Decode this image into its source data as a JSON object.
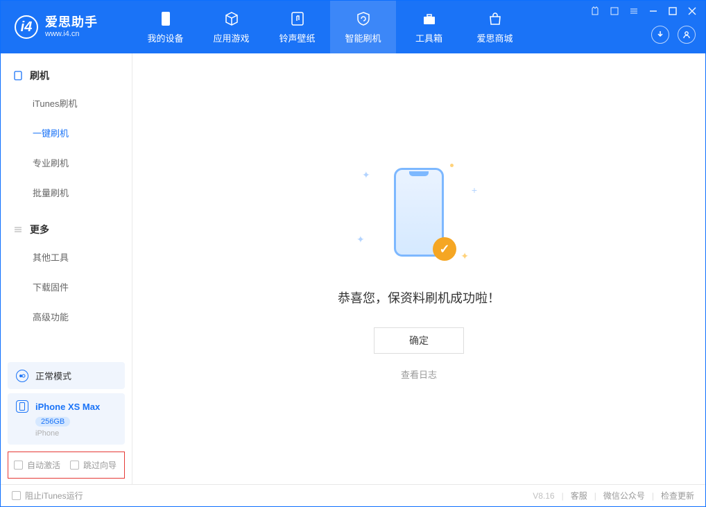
{
  "logo": {
    "title": "爱思助手",
    "subtitle": "www.i4.cn",
    "glyph": "i4"
  },
  "nav": {
    "tabs": [
      {
        "label": "我的设备"
      },
      {
        "label": "应用游戏"
      },
      {
        "label": "铃声壁纸"
      },
      {
        "label": "智能刷机"
      },
      {
        "label": "工具箱"
      },
      {
        "label": "爱思商城"
      }
    ]
  },
  "sidebar": {
    "section1": {
      "title": "刷机",
      "items": [
        {
          "label": "iTunes刷机"
        },
        {
          "label": "一键刷机"
        },
        {
          "label": "专业刷机"
        },
        {
          "label": "批量刷机"
        }
      ]
    },
    "section2": {
      "title": "更多",
      "items": [
        {
          "label": "其他工具"
        },
        {
          "label": "下载固件"
        },
        {
          "label": "高级功能"
        }
      ]
    },
    "mode_card": {
      "label": "正常模式"
    },
    "device": {
      "name": "iPhone XS Max",
      "storage": "256GB",
      "type": "iPhone"
    },
    "checks": {
      "auto_activate": "自动激活",
      "skip_guide": "跳过向导"
    }
  },
  "main": {
    "success_msg": "恭喜您，保资料刷机成功啦！",
    "ok_button": "确定",
    "view_log": "查看日志"
  },
  "footer": {
    "block_itunes": "阻止iTunes运行",
    "version": "V8.16",
    "links": {
      "support": "客服",
      "wechat": "微信公众号",
      "update": "检查更新"
    }
  }
}
